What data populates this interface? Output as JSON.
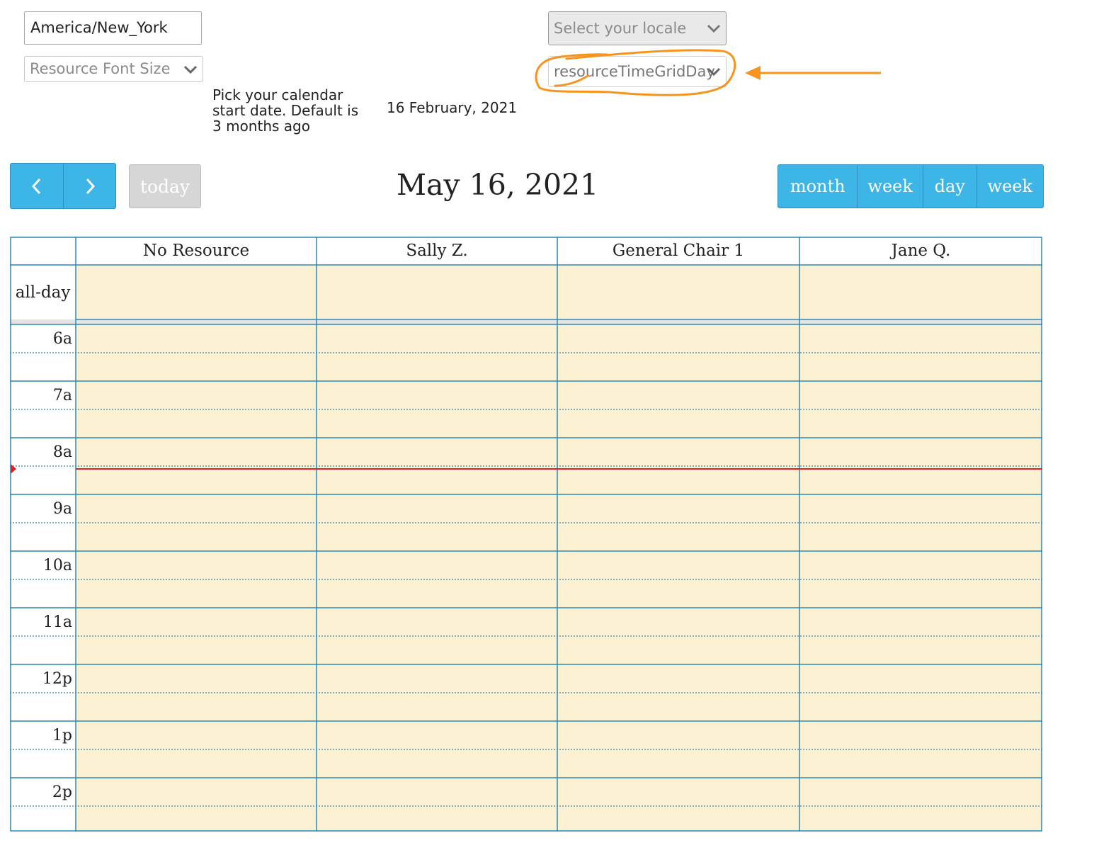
{
  "settings": {
    "timezone_value": "America/New_York",
    "resource_font_size_placeholder": "Resource Font Size",
    "locale_placeholder": "Select your locale",
    "view_select_value": "resourceTimeGridDay",
    "start_date_label": "Pick your calendar start date. Default is 3 months ago",
    "start_date_value": "16 February, 2021"
  },
  "toolbar": {
    "prev_icon": "chevron-left-icon",
    "next_icon": "chevron-right-icon",
    "today_label": "today",
    "title": "May 16, 2021",
    "view_buttons": [
      "month",
      "week",
      "day",
      "week"
    ]
  },
  "calendar": {
    "resources": [
      "No Resource",
      "Sally Z.",
      "General Chair 1",
      "Jane Q."
    ],
    "all_day_label": "all-day",
    "time_slots": [
      "6a",
      "7a",
      "8a",
      "9a",
      "10a",
      "11a",
      "12p",
      "1p",
      "2p"
    ]
  },
  "colors": {
    "button_blue": "#3db5e6",
    "grid_border": "#2f87b5",
    "cell_background": "#fbf0d2",
    "now_indicator": "#e0202a",
    "annotation": "#f7941d"
  }
}
